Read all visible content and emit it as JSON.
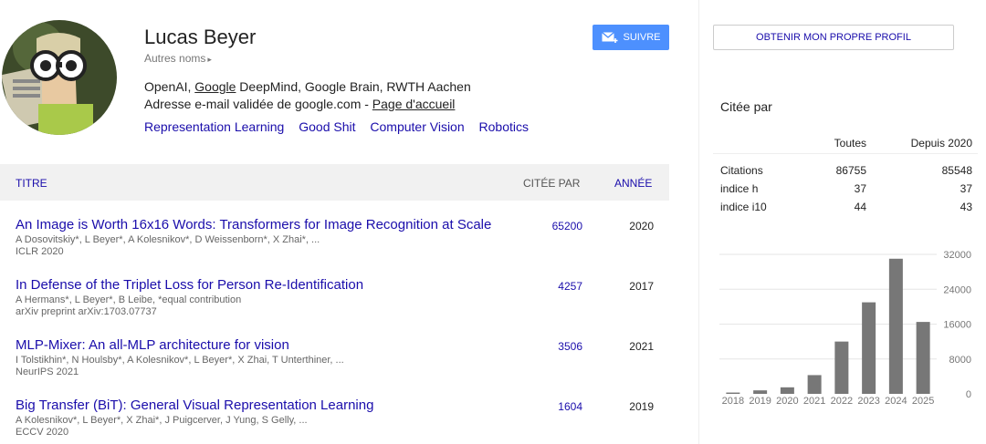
{
  "profile": {
    "name": "Lucas Beyer",
    "aliases_label": "Autres noms",
    "affil_pre": "OpenAI, ",
    "affil_link": "Google",
    "affil_post": " DeepMind, Google Brain, RWTH Aachen",
    "email_text": "Adresse e-mail validée de google.com - ",
    "homepage_label": "Page d'accueil",
    "interests": [
      "Representation Learning",
      "Good Shit",
      "Computer Vision",
      "Robotics"
    ],
    "follow_label": "SUIVRE"
  },
  "table": {
    "col_title": "TITRE",
    "col_cited": "CITÉE PAR",
    "col_year": "ANNÉE",
    "rows": [
      {
        "title": "An Image is Worth 16x16 Words: Transformers for Image Recognition at Scale",
        "authors": "A Dosovitskiy*, L Beyer*, A Kolesnikov*, D Weissenborn*, X Zhai*, ...",
        "venue": "ICLR 2020",
        "cited": "65200",
        "year": "2020"
      },
      {
        "title": "In Defense of the Triplet Loss for Person Re-Identification",
        "authors": "A Hermans*, L Beyer*, B Leibe, *equal contribution",
        "venue": "arXiv preprint arXiv:1703.07737",
        "cited": "4257",
        "year": "2017"
      },
      {
        "title": "MLP-Mixer: An all-MLP architecture for vision",
        "authors": "I Tolstikhin*, N Houlsby*, A Kolesnikov*, L Beyer*, X Zhai, T Unterthiner, ...",
        "venue": "NeurIPS 2021",
        "cited": "3506",
        "year": "2021"
      },
      {
        "title": "Big Transfer (BiT): General Visual Representation Learning",
        "authors": "A Kolesnikov*, L Beyer*, X Zhai*, J Puigcerver, J Yung, S Gelly, ...",
        "venue": "ECCV 2020",
        "cited": "1604",
        "year": "2019"
      }
    ]
  },
  "sidebar": {
    "own_profile_label": "OBTENIR MON PROPRE PROFIL",
    "cited_by_title": "Citée par",
    "stats_header": {
      "all": "Toutes",
      "since": "Depuis 2020"
    },
    "stats": [
      {
        "label": "Citations",
        "all": "86755",
        "since": "85548"
      },
      {
        "label": "indice h",
        "all": "37",
        "since": "37"
      },
      {
        "label": "indice i10",
        "all": "44",
        "since": "43"
      }
    ]
  },
  "chart_data": {
    "type": "bar",
    "categories": [
      "2018",
      "2019",
      "2020",
      "2021",
      "2022",
      "2023",
      "2024",
      "2025"
    ],
    "values": [
      300,
      800,
      1500,
      4300,
      12000,
      21000,
      31000,
      16500
    ],
    "ylim": [
      0,
      32000
    ],
    "yticks": [
      0,
      8000,
      16000,
      24000,
      32000
    ],
    "grid": true,
    "bar_color": "#777777"
  }
}
